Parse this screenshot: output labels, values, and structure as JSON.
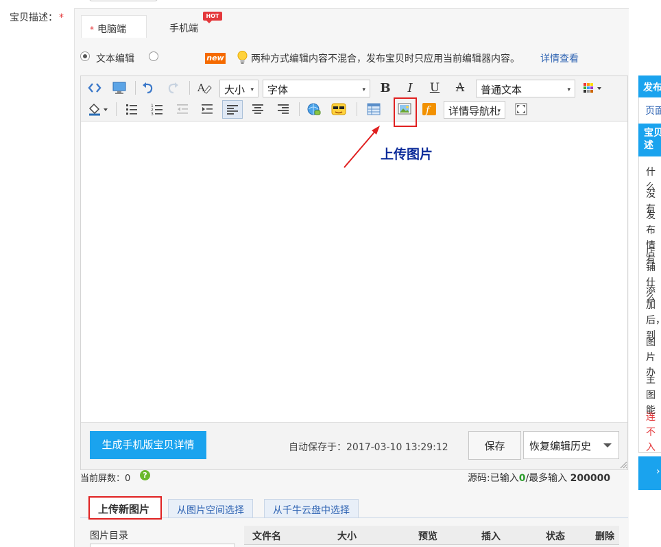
{
  "field": {
    "label": "宝贝描述：",
    "required_mark": "*"
  },
  "device_tabs": {
    "required_mark": "*",
    "pc": "电脑端",
    "mobile": "手机端",
    "hot_badge": "HOT"
  },
  "mode": {
    "text_edit": "文本编辑",
    "new_badge": "new",
    "tip": "两种方式编辑内容不混合，发布宝贝时只应用当前编辑器内容。",
    "tip_link": "详情查看"
  },
  "toolbar": {
    "size_select": "大小",
    "font_select": "字体",
    "format_select": "普通文本",
    "nav_select": "详情导航札",
    "bold": "B",
    "italic": "I",
    "underline": "U",
    "strike": "A"
  },
  "annotation": {
    "upload_image": "上传图片"
  },
  "footer": {
    "generate_mobile": "生成手机版宝贝详情",
    "autosave_label": "自动保存于：2017-03-10 13:29:12",
    "save": "保存",
    "restore_history": "恢复编辑历史"
  },
  "stats": {
    "screen_count": "当前屏数：0",
    "source_prefix": "源码:已输入",
    "source_value": "0",
    "source_mid": "/最多输入",
    "source_max": "200000"
  },
  "upload_tabs": {
    "new": "上传新图片",
    "space": "从图片空间选择",
    "cloud": "从千牛云盘中选择"
  },
  "upload_panel": {
    "dir_label": "图片目录",
    "columns": [
      "文件名",
      "大小",
      "预览",
      "插入",
      "状态",
      "删除"
    ]
  },
  "sidebar": {
    "head1": "发布",
    "link1": "页面",
    "head2": "宝贝述",
    "items": [
      "什么",
      "没有",
      "发布情有",
      "店铺什么",
      "添加后，到",
      "图片办",
      "主图能"
    ],
    "red_item": "连不入道"
  },
  "colors": {
    "accent": "#1aa3ee",
    "link": "#2f64b3",
    "required": "#e4393c",
    "annotation": "#e02020"
  }
}
